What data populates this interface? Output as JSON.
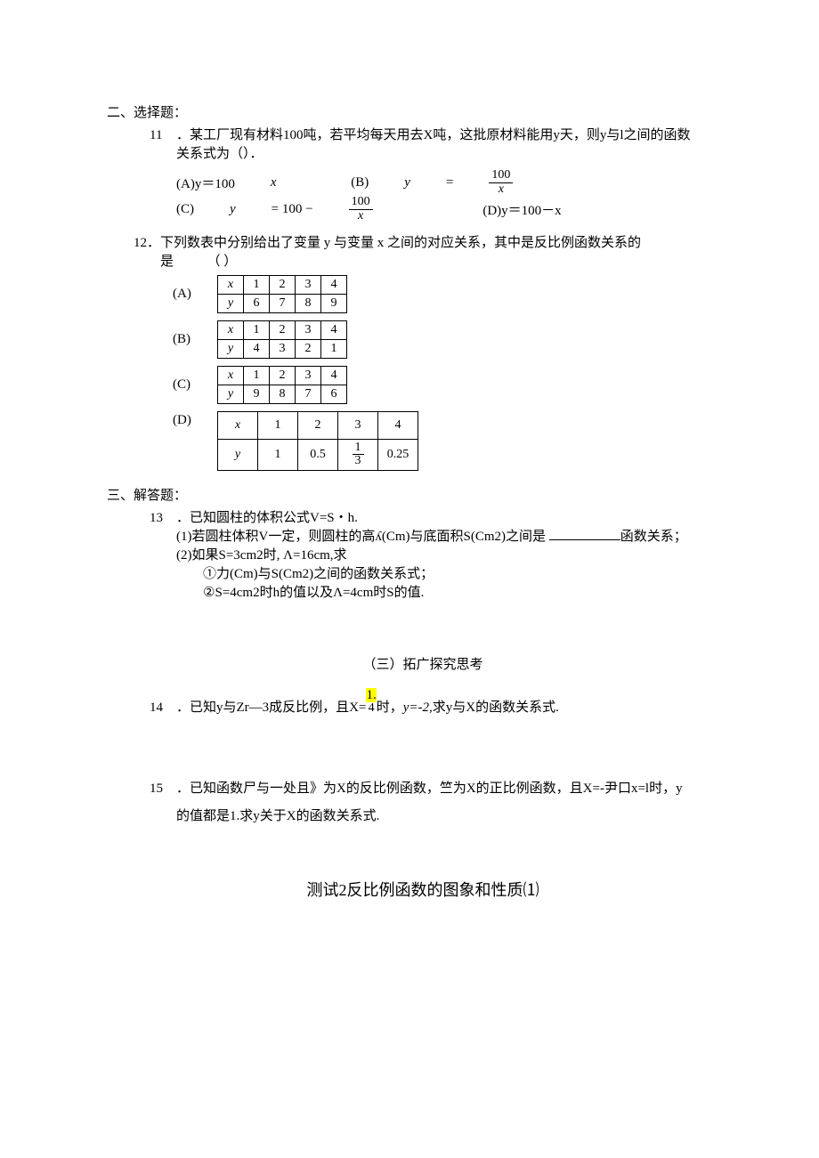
{
  "sec2": {
    "header": "二、选择题：",
    "q11": {
      "num": "11",
      "text1": "．某工厂现有材料100吨，若平均每天用去X吨，这批原材料能用y天，则y与l之间的函数",
      "text2": "关系式为（）．",
      "optA_pre": "(A)y＝100",
      "optA_x": "x",
      "optB_pre": "(B) ",
      "optB_y": "y",
      "optB_eq": " = ",
      "optB_num": "100",
      "optB_den": "x",
      "optC_pre": "(C) ",
      "optC_y": "y",
      "optC_eq": " = 100 − ",
      "optC_num": "100",
      "optC_den": "x",
      "optD": "(D)y＝100－x"
    },
    "q12": {
      "num": "12．",
      "text1": "下列数表中分别给出了变量 y 与变量 x 之间的对应关系，其中是反比例函数关系的",
      "text2": "是",
      "paren": "（      ）",
      "labA": "(A)",
      "labB": "(B)",
      "labC": "(C)",
      "labD": "(D)",
      "xlabel": "x",
      "ylabel": "y",
      "tA_x": [
        "1",
        "2",
        "3",
        "4"
      ],
      "tA_y": [
        "6",
        "7",
        "8",
        "9"
      ],
      "tB_x": [
        "1",
        "2",
        "3",
        "4"
      ],
      "tB_y": [
        "4",
        "3",
        "2",
        "1"
      ],
      "tC_x": [
        "1",
        "2",
        "3",
        "4"
      ],
      "tC_y": [
        "9",
        "8",
        "7",
        "6"
      ],
      "tD_x": [
        "1",
        "2",
        "3",
        "4"
      ],
      "tD_y": [
        "1",
        "0.5",
        "",
        "0.25"
      ],
      "tD_y3_num": "1",
      "tD_y3_den": "3"
    }
  },
  "sec3": {
    "header": "三、解答题：",
    "q13": {
      "num": "13",
      "lead": "．已知圆柱的体积公式V=S・h.",
      "p1a": "(1)若圆柱体积V一定，则圆柱的高ʎ(Cm)与底面积S(Cm2)之间是 ",
      "p1b": "函数关系；",
      "p2": "(2)如果S=3cm2时, Λ=16cm,求",
      "p2a": "①力(Cm)与S(Cm2)之间的函数关系式；",
      "p2b": "②S=4cm2时h的值以及Λ=4cm时S的值."
    },
    "subheader": "（三）拓广探究思考",
    "q14": {
      "num": "14",
      "t1": "．已知y与Zr—3成反比例，且X=",
      "hl": "1.",
      "t2": "时，",
      "yi": "y=-2,",
      "t3": "求y与X的函数关系式.",
      "under": "4"
    },
    "q15": {
      "num": "15",
      "t1": "．已知函数尸与一处且》为X的反比例函数，竺为X的正比例函数，且X=-尹口x=l时，y",
      "t2": "的值都是1.求y关于X的函数关系式."
    }
  },
  "title2": "测试2反比例函数的图象和性质⑴"
}
